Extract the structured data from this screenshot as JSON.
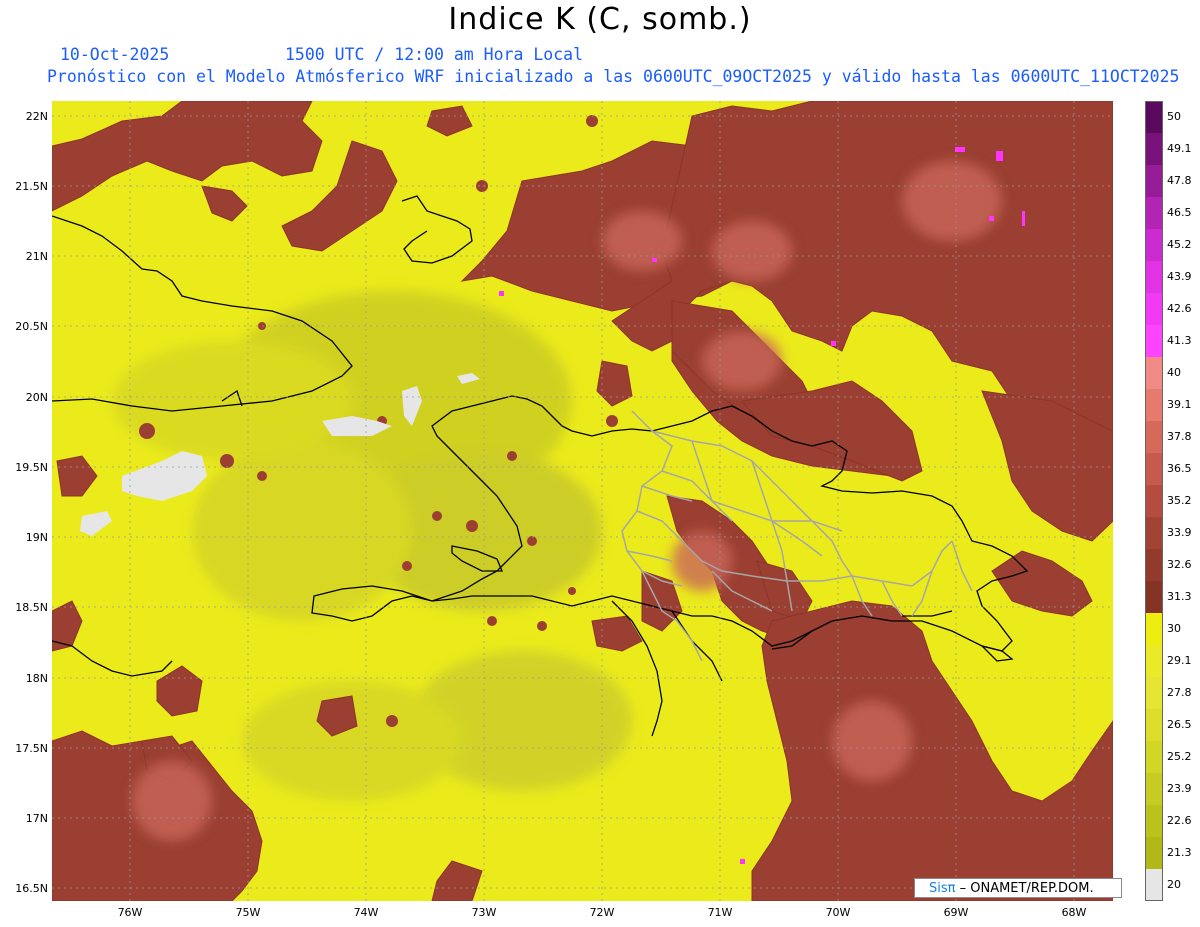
{
  "header": {
    "title": "Indice K (C, somb.)",
    "date": "10-Oct-2025",
    "time": "1500 UTC / 12:00 am Hora Local",
    "subtitle": "Pronóstico con el Modelo Atmósferico WRF inicializado a las 0600UTC_09OCT2025 y válido hasta las  0600UTC_11OCT2025"
  },
  "axes": {
    "lat_labels": [
      "22N",
      "21.5N",
      "21N",
      "20.5N",
      "20N",
      "19.5N",
      "19N",
      "18.5N",
      "18N",
      "17.5N",
      "17N",
      "16.5N"
    ],
    "lon_labels": [
      "76W",
      "75W",
      "74W",
      "73W",
      "72W",
      "71W",
      "70W",
      "69W",
      "68W"
    ]
  },
  "colorbar": {
    "labels": [
      "50",
      "49.1",
      "47.8",
      "46.5",
      "45.2",
      "43.9",
      "42.6",
      "41.3",
      "40",
      "39.1",
      "37.8",
      "36.5",
      "35.2",
      "33.9",
      "32.6",
      "31.3",
      "30",
      "29.1",
      "27.8",
      "26.5",
      "25.2",
      "23.9",
      "22.6",
      "21.3",
      "20"
    ],
    "colors": [
      "#5a0a5c",
      "#78127a",
      "#951b97",
      "#b224b4",
      "#cc2ccf",
      "#e133e4",
      "#f23af4",
      "#ff44ff",
      "#f28a86",
      "#e57a6d",
      "#d56a5b",
      "#c65a4c",
      "#b44c3f",
      "#a34334",
      "#923a2b",
      "#843324",
      "#eded10",
      "#eaea28",
      "#e6e632",
      "#dede2a",
      "#d2d624",
      "#c6cc22",
      "#bac21c",
      "#b2b818",
      "#e6e6e6"
    ]
  },
  "credit": {
    "sis": "Sisπ",
    "rest": "– ONAMET/REP.DOM."
  }
}
